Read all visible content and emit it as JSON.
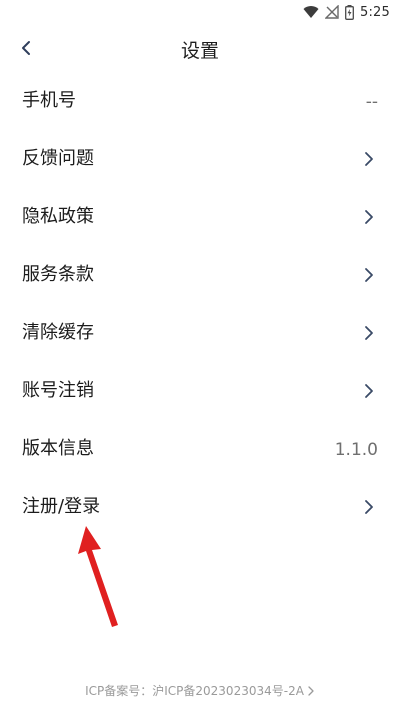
{
  "status_bar": {
    "time": "5:25",
    "icons": [
      "wifi-icon",
      "signal-off-icon",
      "battery-icon"
    ]
  },
  "header": {
    "title": "设置",
    "back_icon": "chevron-left-icon"
  },
  "settings": {
    "phone": {
      "label": "手机号",
      "value": "--"
    },
    "feedback": {
      "label": "反馈问题"
    },
    "privacy": {
      "label": "隐私政策"
    },
    "terms": {
      "label": "服务条款"
    },
    "cache": {
      "label": "清除缓存"
    },
    "delete_account": {
      "label": "账号注销"
    },
    "version": {
      "label": "版本信息",
      "value": "1.1.0"
    },
    "register_login": {
      "label": "注册/登录"
    }
  },
  "annotation": {
    "arrow_color": "#e02020"
  },
  "footer": {
    "icp_label": "ICP备案号：",
    "icp_number": "沪ICP备2023023034号-2A"
  },
  "colors": {
    "text": "#1c1c1c",
    "secondary": "#6f6f6f",
    "chevron": "#3a4a66",
    "footer": "#9a9a9a"
  }
}
